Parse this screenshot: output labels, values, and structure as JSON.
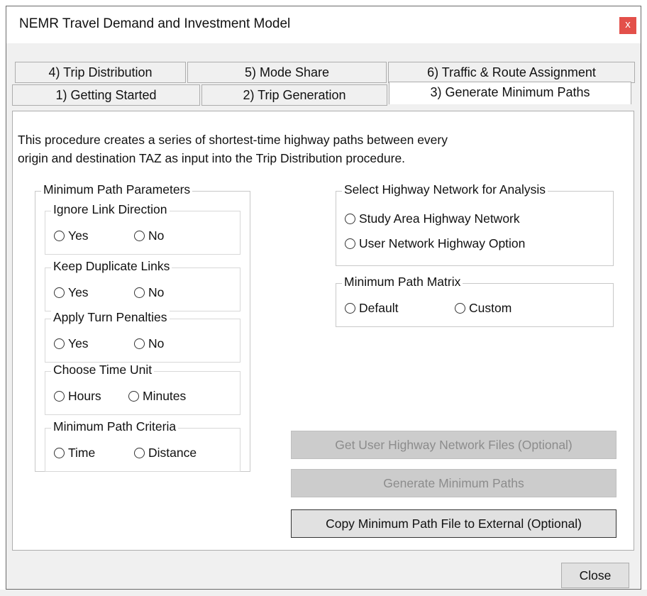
{
  "window": {
    "title": "NEMR Travel Demand and Investment Model",
    "close_glyph": "x"
  },
  "tabs": {
    "row_back": [
      "4) Trip Distribution",
      "5) Mode Share",
      "6) Traffic & Route Assignment"
    ],
    "row_front": [
      "1) Getting Started",
      "2) Trip Generation",
      "3) Generate Minimum Paths"
    ],
    "active": "3) Generate Minimum Paths"
  },
  "description": {
    "line1": "This procedure creates a series of shortest-time highway paths between every",
    "line2": "origin and destination TAZ as input into the Trip Distribution procedure."
  },
  "min_path_params": {
    "title": "Minimum Path Parameters",
    "ignore_link_direction": {
      "title": "Ignore Link Direction",
      "opt1": "Yes",
      "opt2": "No"
    },
    "keep_duplicate_links": {
      "title": "Keep Duplicate Links",
      "opt1": "Yes",
      "opt2": "No"
    },
    "apply_turn_penalties": {
      "title": "Apply Turn Penalties",
      "opt1": "Yes",
      "opt2": "No"
    },
    "choose_time_unit": {
      "title": "Choose Time Unit",
      "opt1": "Hours",
      "opt2": "Minutes"
    },
    "min_path_criteria": {
      "title": "Minimum Path Criteria",
      "opt1": "Time",
      "opt2": "Distance"
    }
  },
  "highway_network": {
    "title": "Select Highway Network for Analysis",
    "opt1": "Study Area Highway Network",
    "opt2": "User Network Highway Option"
  },
  "min_path_matrix": {
    "title": "Minimum Path Matrix",
    "opt1": "Default",
    "opt2": "Custom"
  },
  "buttons": {
    "get_user_files": "Get User Highway Network Files (Optional)",
    "generate": "Generate Minimum Paths",
    "copy_external": "Copy Minimum Path File to External (Optional)",
    "close": "Close"
  },
  "colors": {
    "close_red": "#e3504a",
    "window_bg": "#f0f0f0",
    "disabled_btn": "#cccccc"
  }
}
